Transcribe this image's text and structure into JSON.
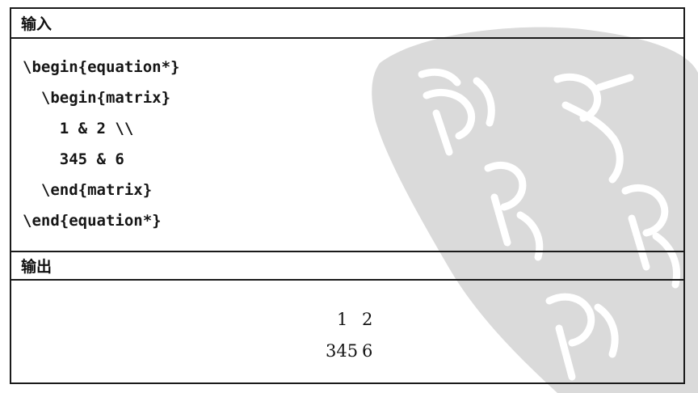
{
  "input_section": {
    "heading": "输入",
    "code_lines": [
      "\\begin{equation*}",
      "  \\begin{matrix}",
      "    1 & 2 \\\\",
      "    345 & 6",
      "  \\end{matrix}",
      "\\end{equation*}"
    ]
  },
  "output_section": {
    "heading": "输出",
    "matrix_rows": [
      [
        "1",
        "2"
      ],
      [
        "345",
        "6"
      ]
    ]
  }
}
